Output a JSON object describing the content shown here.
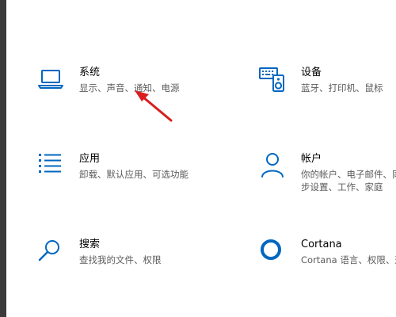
{
  "accent_color": "#0067c0",
  "annotation_color": "#d81e1e",
  "tiles": {
    "system": {
      "title": "系统",
      "desc": "显示、声音、通知、电源",
      "icon": "laptop-icon"
    },
    "devices": {
      "title": "设备",
      "desc": "蓝牙、打印机、鼠标",
      "icon": "keyboard-speaker-icon"
    },
    "apps": {
      "title": "应用",
      "desc": "卸载、默认应用、可选功能",
      "icon": "apps-list-icon"
    },
    "accounts": {
      "title": "帐户",
      "desc": "你的帐户、电子邮件、同步设置、工作、家庭",
      "icon": "person-icon"
    },
    "search": {
      "title": "搜索",
      "desc": "查找我的文件、权限",
      "icon": "search-icon"
    },
    "cortana": {
      "title": "Cortana",
      "desc": "Cortana 语言、权限、通知",
      "icon": "cortana-ring-icon"
    }
  }
}
